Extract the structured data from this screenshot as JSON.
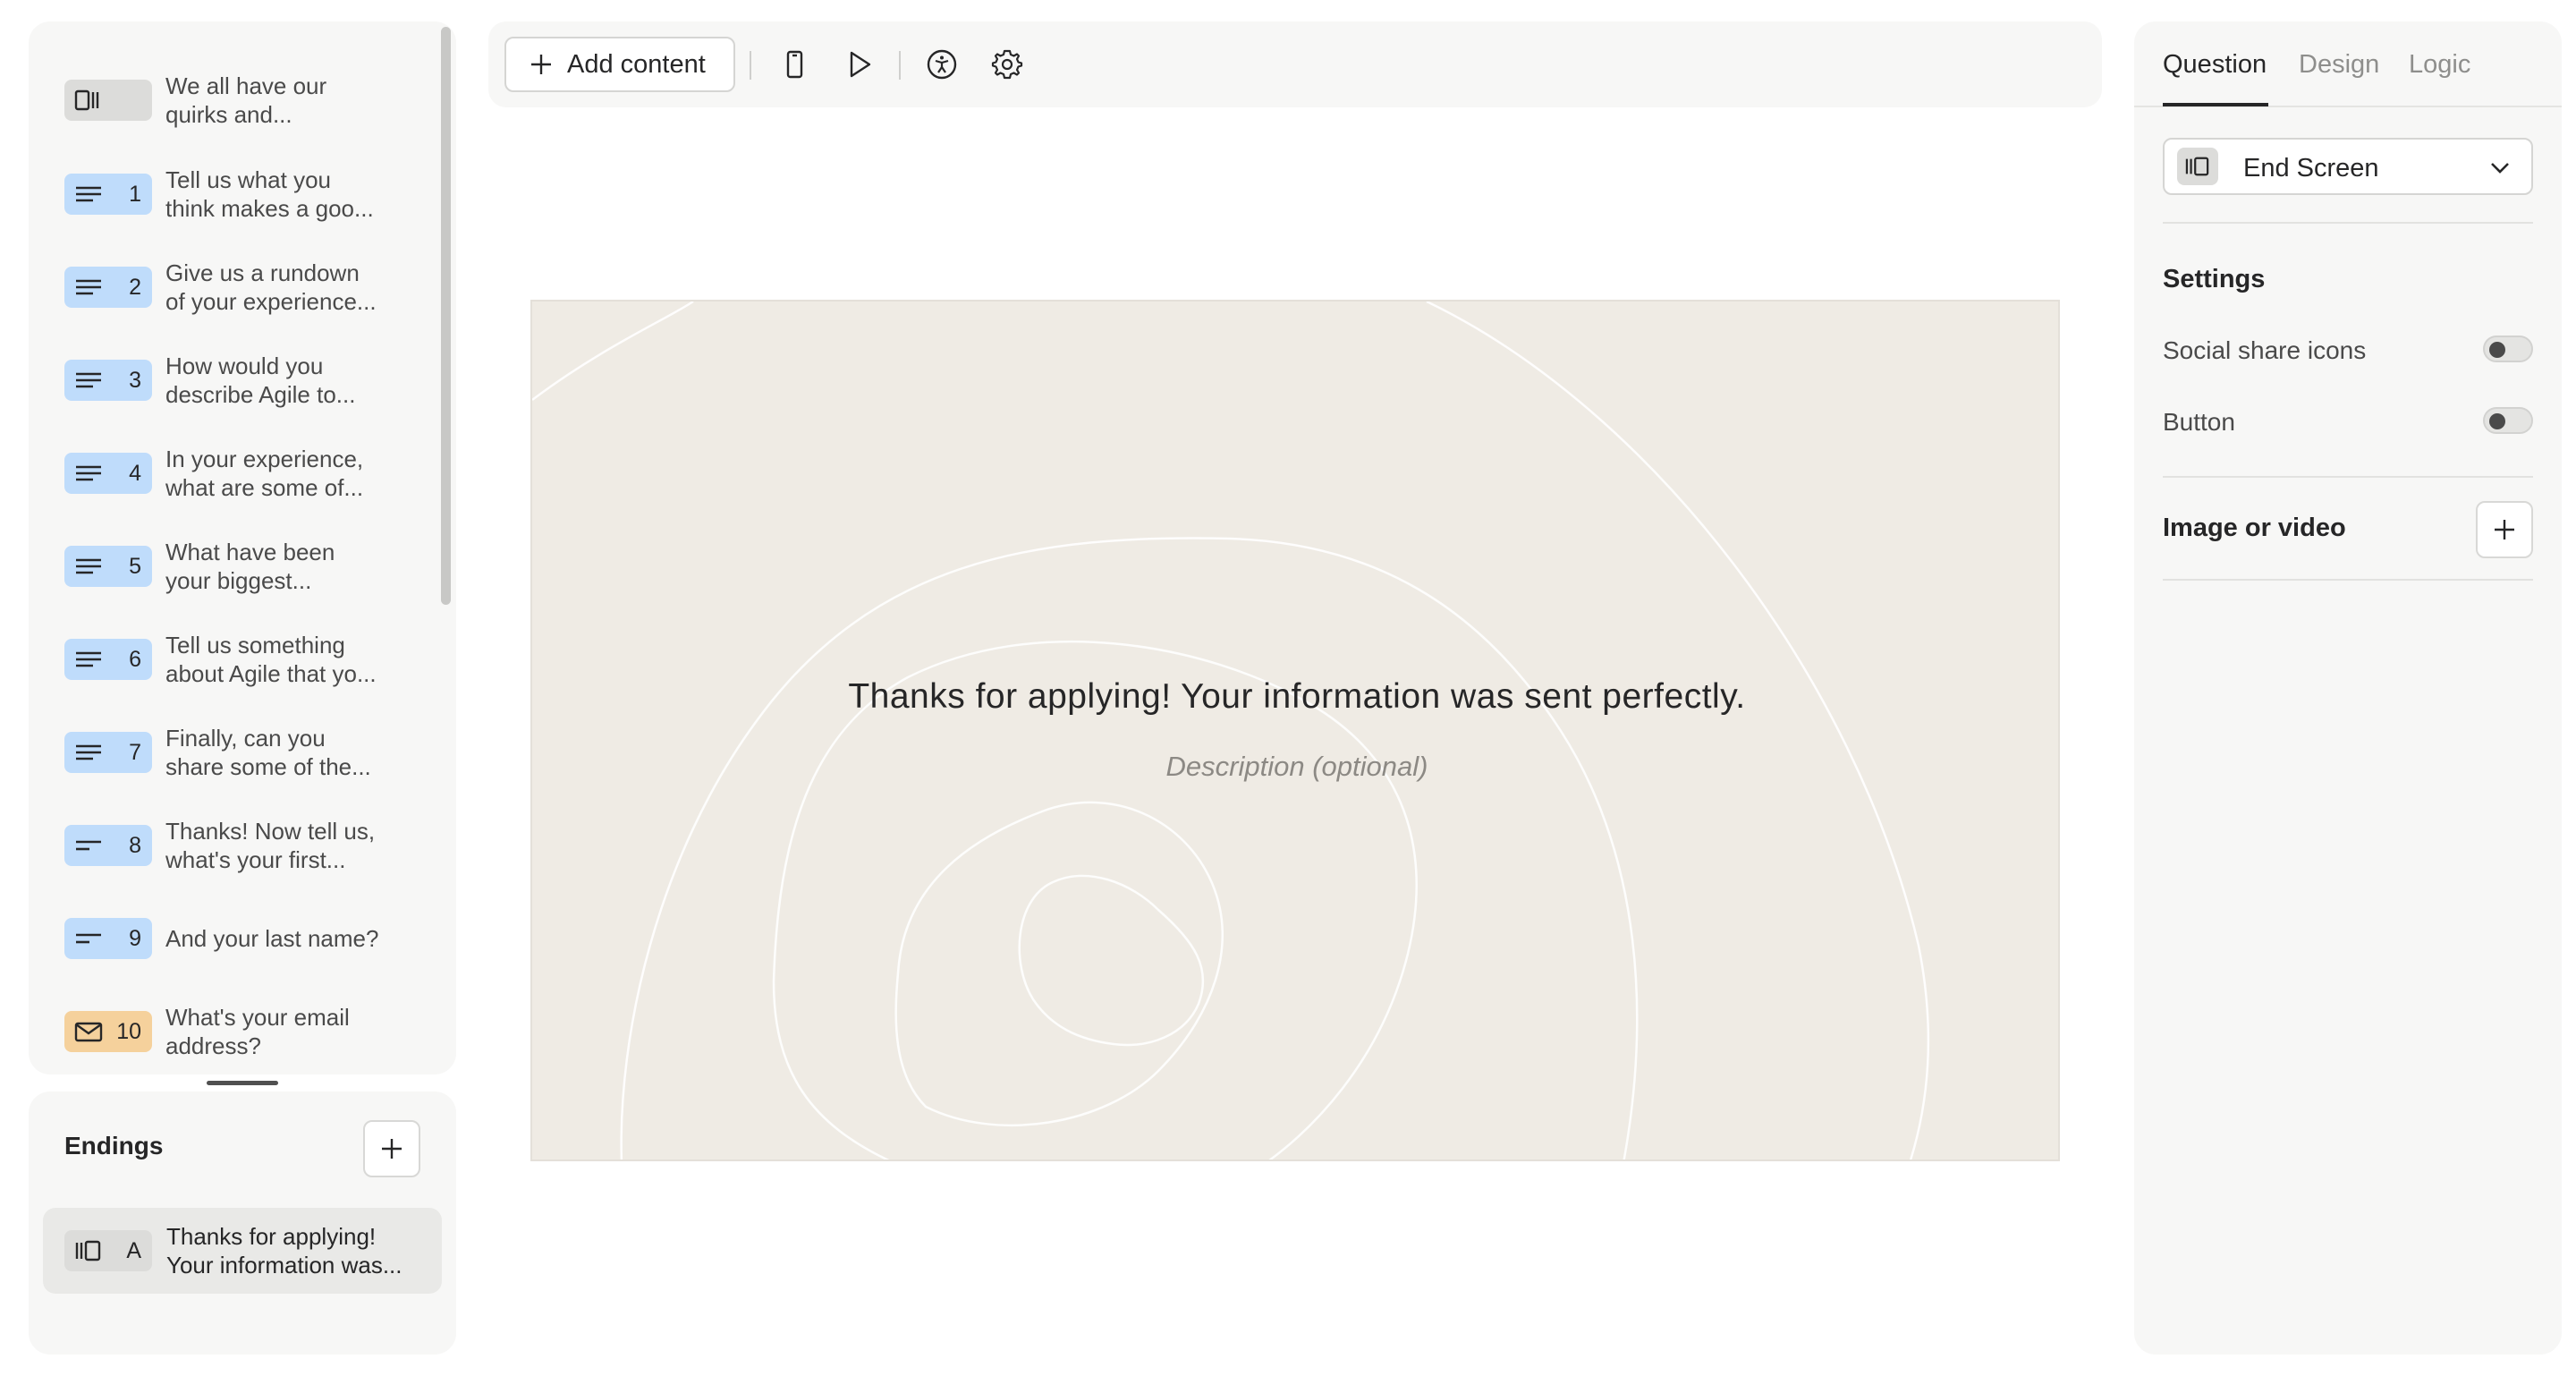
{
  "questions": [
    {
      "badge": "",
      "type": "welcome",
      "color": "gray",
      "line1": "We all have our",
      "line2": "quirks and..."
    },
    {
      "badge": "1",
      "type": "long-text",
      "color": "blue",
      "line1": "Tell us what you",
      "line2": "think makes a goo..."
    },
    {
      "badge": "2",
      "type": "long-text",
      "color": "blue",
      "line1": "Give us a rundown",
      "line2": "of your experience..."
    },
    {
      "badge": "3",
      "type": "long-text",
      "color": "blue",
      "line1": "How would you",
      "line2": "describe Agile to..."
    },
    {
      "badge": "4",
      "type": "long-text",
      "color": "blue",
      "line1": "In your experience,",
      "line2": "what are some of..."
    },
    {
      "badge": "5",
      "type": "long-text",
      "color": "blue",
      "line1": "What have been",
      "line2": "your biggest..."
    },
    {
      "badge": "6",
      "type": "long-text",
      "color": "blue",
      "line1": "Tell us something",
      "line2": "about Agile that yo..."
    },
    {
      "badge": "7",
      "type": "long-text",
      "color": "blue",
      "line1": "Finally, can you",
      "line2": "share some of the..."
    },
    {
      "badge": "8",
      "type": "short-text",
      "color": "blue",
      "line1": "Thanks! Now tell us,",
      "line2": "what's your first..."
    },
    {
      "badge": "9",
      "type": "short-text",
      "color": "blue",
      "line1": "And your last name?",
      "line2": ""
    },
    {
      "badge": "10",
      "type": "email",
      "color": "orange",
      "line1": "What's your email",
      "line2": "address?"
    }
  ],
  "endings": {
    "title": "Endings",
    "items": [
      {
        "badge": "A",
        "line1": "Thanks for applying!",
        "line2": "Your information was..."
      }
    ]
  },
  "toolbar": {
    "add_label": "Add content"
  },
  "canvas": {
    "title": "Thanks for applying! Your information was sent perfectly.",
    "description_placeholder": "Description (optional)"
  },
  "right_panel": {
    "tabs": [
      "Question",
      "Design",
      "Logic"
    ],
    "active_tab": "Question",
    "type_select": "End Screen",
    "settings_heading": "Settings",
    "settings": [
      {
        "label": "Social share icons",
        "enabled": false
      },
      {
        "label": "Button",
        "enabled": false
      }
    ],
    "media_label": "Image or video"
  },
  "colors": {
    "panel_bg": "#f7f7f6",
    "canvas_bg": "#efebe4",
    "badge_blue": "#bfdcfb",
    "badge_orange": "#f5d19c",
    "badge_gray": "#dcdcda"
  }
}
